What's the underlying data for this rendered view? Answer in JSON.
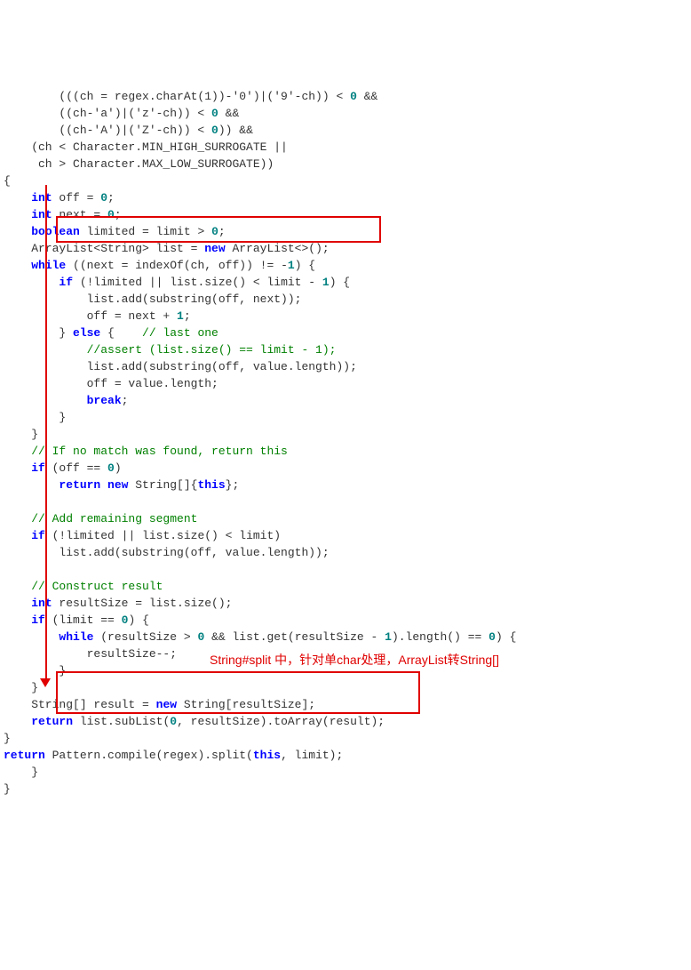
{
  "code": {
    "l01": "        (((ch = regex.charAt(1))-'0')|('9'-ch)) < ",
    "l01n": "0",
    "l01b": " &&",
    "l02": "        ((ch-'a')|('z'-ch)) < ",
    "l02n": "0",
    "l02b": " &&",
    "l03": "        ((ch-'A')|('Z'-ch)) < ",
    "l03n": "0",
    "l03b": ")) &&",
    "l04": "    (ch < Character.MIN_HIGH_SURROGATE ||",
    "l05": "     ch > Character.MAX_LOW_SURROGATE))",
    "l06": "{",
    "l07a": "    ",
    "l07k": "int",
    "l07b": " off = ",
    "l07n": "0",
    "l07c": ";",
    "l08a": "    ",
    "l08k": "int",
    "l08b": " next = ",
    "l08n": "0",
    "l08c": ";",
    "l09a": "    ",
    "l09k": "boolean",
    "l09b": " limited = limit > ",
    "l09n": "0",
    "l09c": ";",
    "l10a": "    ArrayList<String> list = ",
    "l10k": "new",
    "l10b": " ArrayList<>();",
    "l11a": "    ",
    "l11k": "while",
    "l11b": " ((next = indexOf(ch, off)) != -",
    "l11n": "1",
    "l11c": ") {",
    "l12a": "        ",
    "l12k": "if",
    "l12b": " (!limited || list.size() < limit - ",
    "l12n": "1",
    "l12c": ") {",
    "l13": "            list.add(substring(off, next));",
    "l14a": "            off = next + ",
    "l14n": "1",
    "l14b": ";",
    "l15a": "        } ",
    "l15k": "else",
    "l15b": " {    ",
    "l15c": "// last one",
    "l16": "            //assert (list.size() == limit - 1);",
    "l17": "            list.add(substring(off, value.length));",
    "l18": "            off = value.length;",
    "l19a": "            ",
    "l19k": "break",
    "l19b": ";",
    "l20": "        }",
    "l21": "    }",
    "l22": "    // If no match was found, return this",
    "l23a": "    ",
    "l23k": "if",
    "l23b": " (off == ",
    "l23n": "0",
    "l23c": ")",
    "l24a": "        ",
    "l24k": "return new",
    "l24b": " String[]{",
    "l24k2": "this",
    "l24c": "};",
    "l25": "",
    "l26": "    // Add remaining segment",
    "l27a": "    ",
    "l27k": "if",
    "l27b": " (!limited || list.size() < limit)",
    "l28": "        list.add(substring(off, value.length));",
    "l29": "",
    "l30": "    // Construct result",
    "l31a": "    ",
    "l31k": "int",
    "l31b": " resultSize = list.size();",
    "l32a": "    ",
    "l32k": "if",
    "l32b": " (limit == ",
    "l32n": "0",
    "l32c": ") {",
    "l33a": "        ",
    "l33k": "while",
    "l33b": " (resultSize > ",
    "l33n": "0",
    "l33c": " && list.get(resultSize - ",
    "l33n2": "1",
    "l33d": ").length() == ",
    "l33n3": "0",
    "l33e": ") {",
    "l34": "            resultSize--;",
    "l35": "        }",
    "l36": "    }",
    "l37a": "    String[] result = ",
    "l37k": "new",
    "l37b": " String[resultSize];",
    "l38a": "    ",
    "l38k": "return",
    "l38b": " list.subList(",
    "l38n": "0",
    "l38c": ", resultSize).toArray(result);",
    "l39": "}",
    "l40a": "",
    "l40k": "return",
    "l40b": " Pattern.compile(regex).split(",
    "l40k2": "this",
    "l40c": ", limit);"
  },
  "annotation": "String#split 中，针对单char处理，ArrayList转String[]"
}
